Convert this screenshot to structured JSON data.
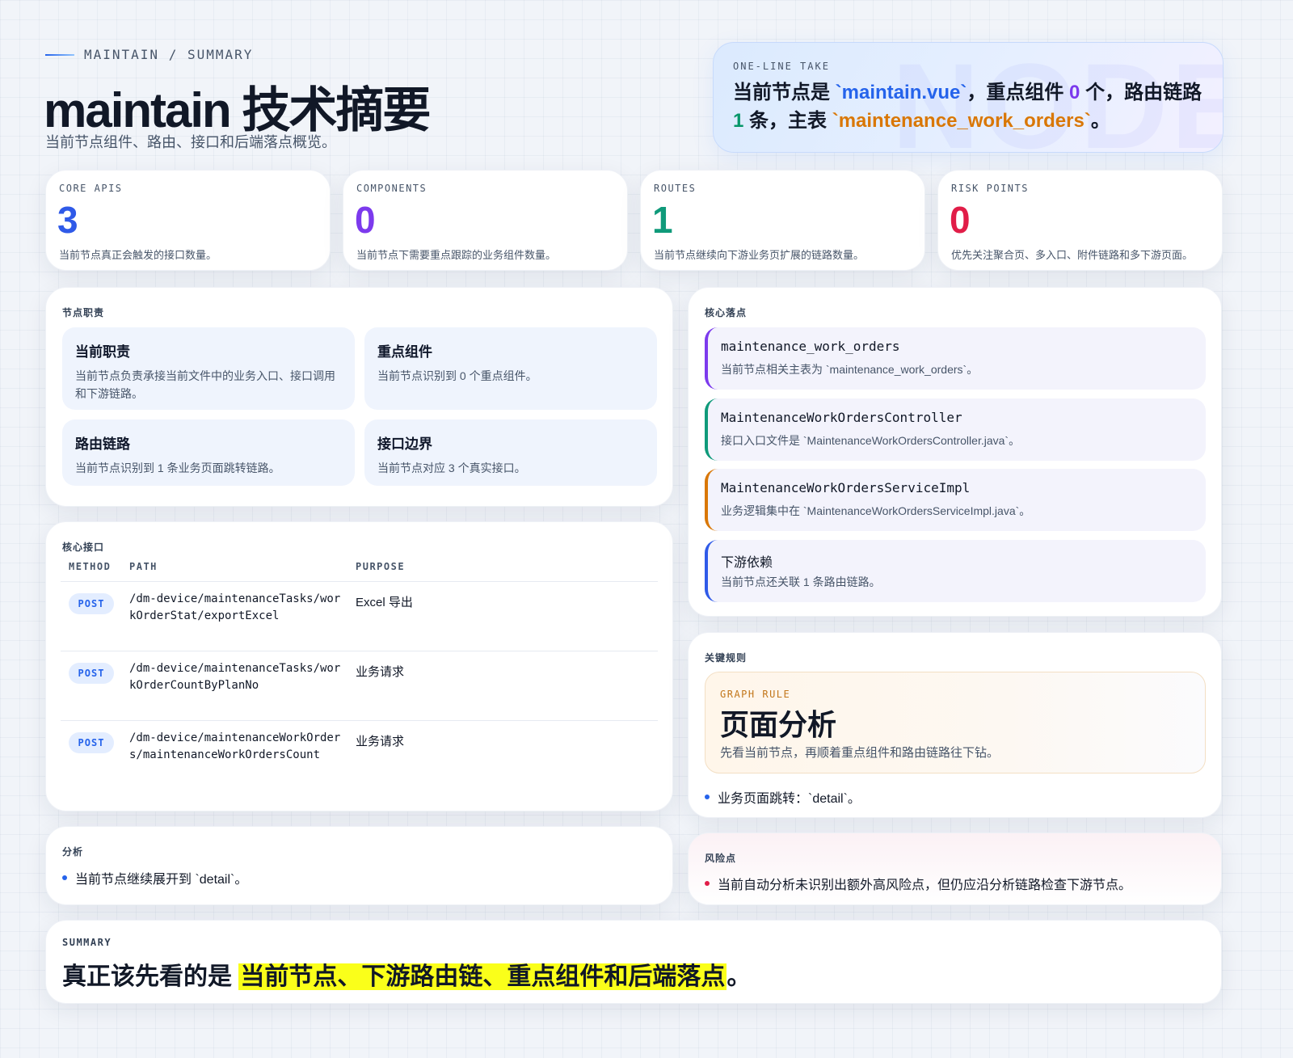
{
  "header": {
    "eyebrow": "MAINTAIN / SUMMARY",
    "title": "maintain 技术摘要",
    "subtitle": "当前节点组件、路由、接口和后端落点概览。"
  },
  "take": {
    "label": "ONE-LINE TAKE",
    "watermark": "NODE",
    "t1": "当前节点是 ",
    "file": "`maintain.vue`",
    "t2": "，重点组件 ",
    "components": "0",
    "t3": " 个，路由链路 ",
    "routes": "1",
    "t4": " 条，主表 ",
    "table": "`maintenance_work_orders`",
    "t5": "。"
  },
  "stats": [
    {
      "label": "CORE APIS",
      "value": "3",
      "desc": "当前节点真正会触发的接口数量。",
      "color": "#2f5ae8"
    },
    {
      "label": "COMPONENTS",
      "value": "0",
      "desc": "当前节点下需要重点跟踪的业务组件数量。",
      "color": "#7c3aed"
    },
    {
      "label": "ROUTES",
      "value": "1",
      "desc": "当前节点继续向下游业务页扩展的链路数量。",
      "color": "#0f9a7a"
    },
    {
      "label": "RISK POINTS",
      "value": "0",
      "desc": "优先关注聚合页、多入口、附件链路和多下游页面。",
      "color": "#e11d48"
    }
  ],
  "role": {
    "title": "节点职责",
    "tiles": [
      {
        "title": "当前职责",
        "desc": "当前节点负责承接当前文件中的业务入口、接口调用和下游链路。"
      },
      {
        "title": "重点组件",
        "desc": "当前节点识别到 0 个重点组件。"
      },
      {
        "title": "路由链路",
        "desc": "当前节点识别到 1 条业务页面跳转链路。"
      },
      {
        "title": "接口边界",
        "desc": "当前节点对应 3 个真实接口。"
      }
    ]
  },
  "api": {
    "title": "核心接口",
    "columns": [
      "METHOD",
      "PATH",
      "PURPOSE"
    ],
    "rows": [
      {
        "method": "POST",
        "path": "/dm-device/maintenanceTasks/workOrderStat/exportExcel",
        "purpose": "Excel 导出"
      },
      {
        "method": "POST",
        "path": "/dm-device/maintenanceTasks/workOrderCountByPlanNo",
        "purpose": "业务请求"
      },
      {
        "method": "POST",
        "path": "/dm-device/maintenanceWorkOrders/maintenanceWorkOrdersCount",
        "purpose": "业务请求"
      }
    ]
  },
  "landing": {
    "title": "核心落点",
    "items": [
      {
        "title": "maintenance_work_orders",
        "desc": "当前节点相关主表为 `maintenance_work_orders`。",
        "color": "#7c3aed",
        "mono": true
      },
      {
        "title": "MaintenanceWorkOrdersController",
        "desc": "接口入口文件是 `MaintenanceWorkOrdersController.java`。",
        "color": "#0f9a7a",
        "mono": true
      },
      {
        "title": "MaintenanceWorkOrdersServiceImpl",
        "desc": "业务逻辑集中在 `MaintenanceWorkOrdersServiceImpl.java`。",
        "color": "#d97706",
        "mono": true
      },
      {
        "title": "下游依赖",
        "desc": "当前节点还关联 1 条路由链路。",
        "color": "#2f5ae8",
        "mono": false
      }
    ]
  },
  "rules": {
    "title": "关键规则",
    "box_label": "GRAPH RULE",
    "box_title": "页面分析",
    "box_desc": "先看当前节点，再顺着重点组件和路由链路往下钻。",
    "bullet": "业务页面跳转：`detail`。"
  },
  "analysis": {
    "title": "分析",
    "bullet": "当前节点继续展开到 `detail`。"
  },
  "risk": {
    "title": "风险点",
    "bullet": "当前自动分析未识别出额外高风险点，但仍应沿分析链路检查下游节点。"
  },
  "summary": {
    "label": "SUMMARY",
    "lead": "真正该先看的是 ",
    "highlight": "当前节点、下游路由链、重点组件和后端落点",
    "end": "。"
  }
}
